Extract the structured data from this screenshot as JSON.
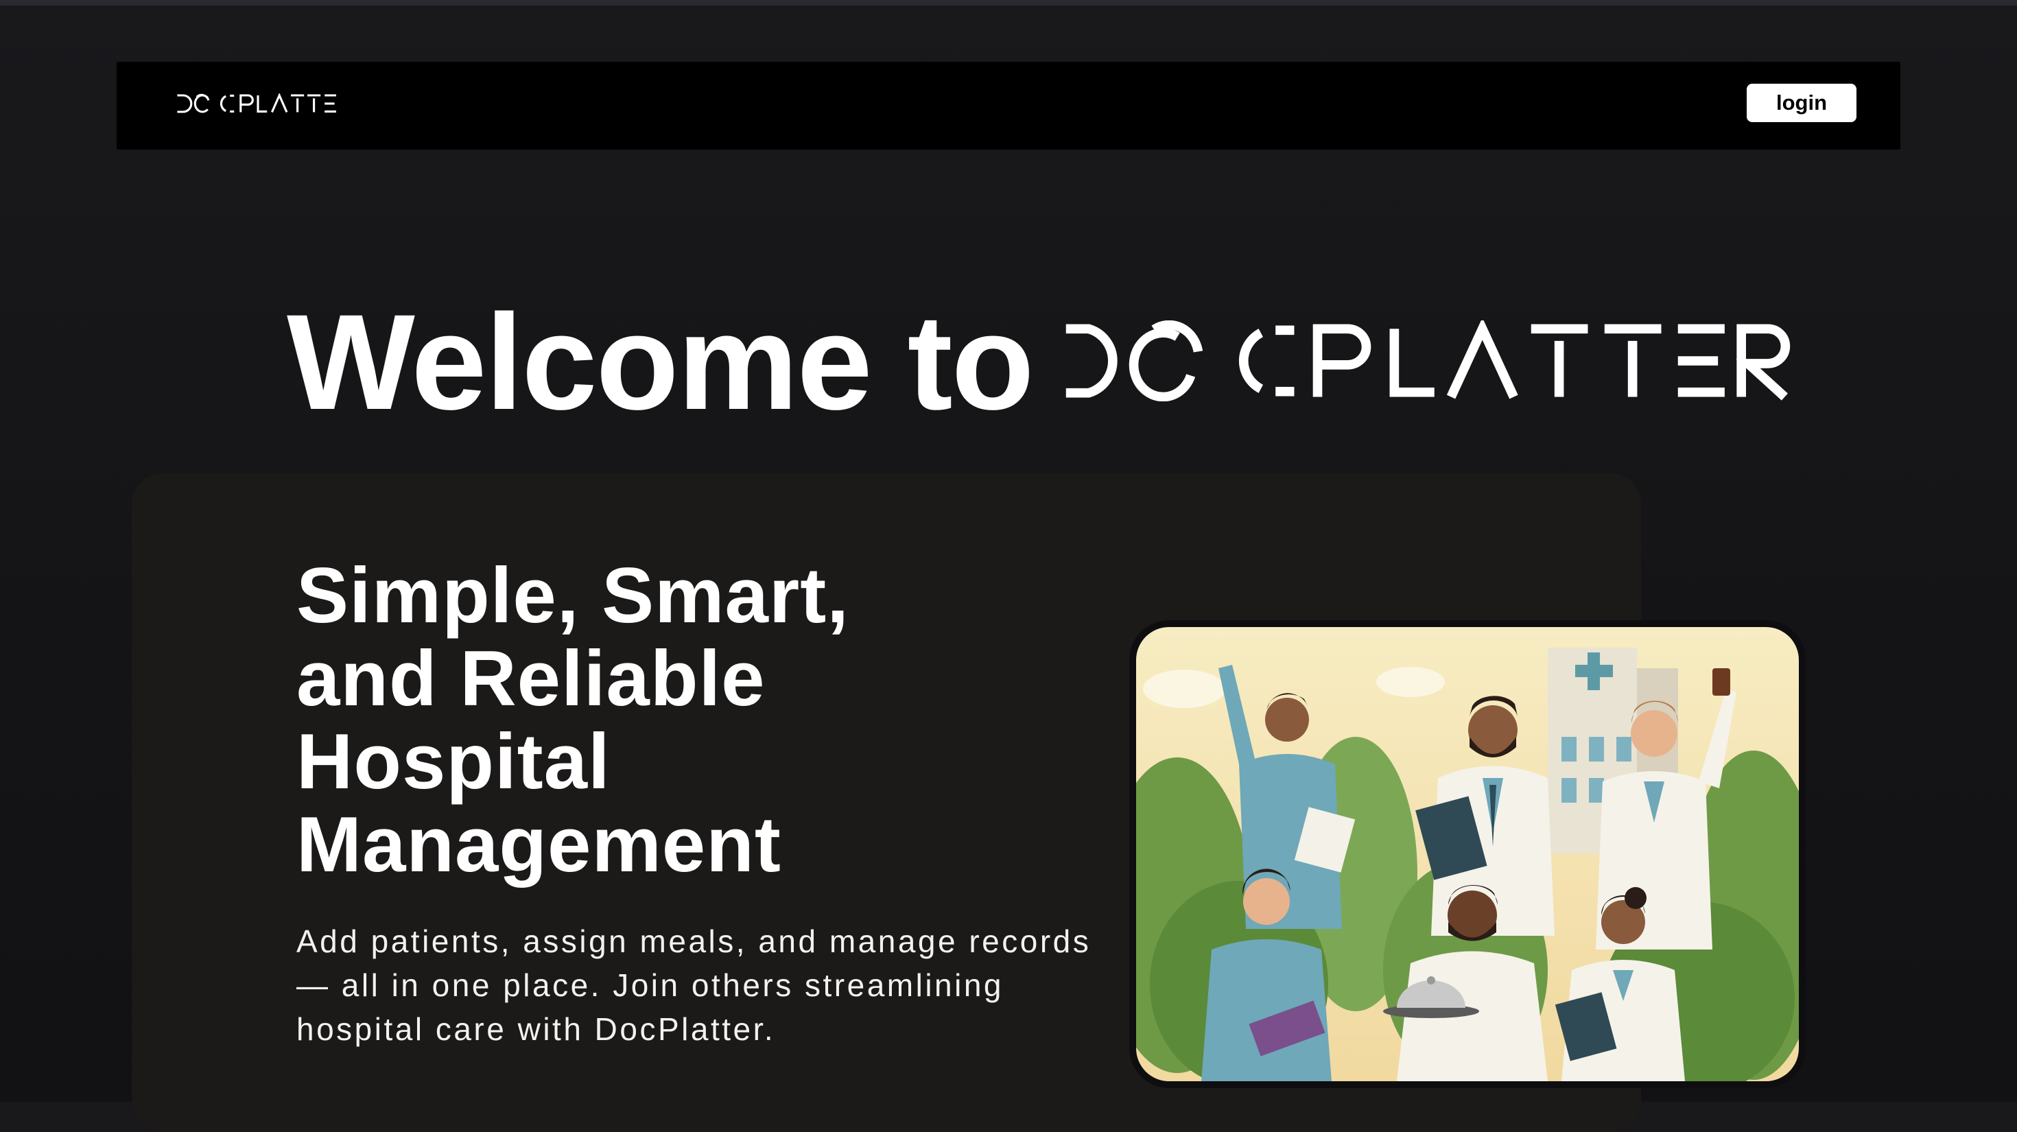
{
  "header": {
    "logo_text": "DOCPLATTER",
    "login_label": "login"
  },
  "hero": {
    "welcome_text": "Welcome to",
    "brand_text": "DOCPLATTER"
  },
  "feature": {
    "headline_lines": [
      "Simple, Smart,",
      "and Reliable",
      "Hospital",
      "Management"
    ],
    "description": "Add patients, assign meals, and manage records — all in one place. Join others streamlining hospital care with DocPlatter.",
    "illustration": "doctors-and-nurses-illustration"
  },
  "colors": {
    "background": "#151517",
    "navbar": "#000000",
    "card": "#1c1a19",
    "accent": "#ffffff"
  }
}
